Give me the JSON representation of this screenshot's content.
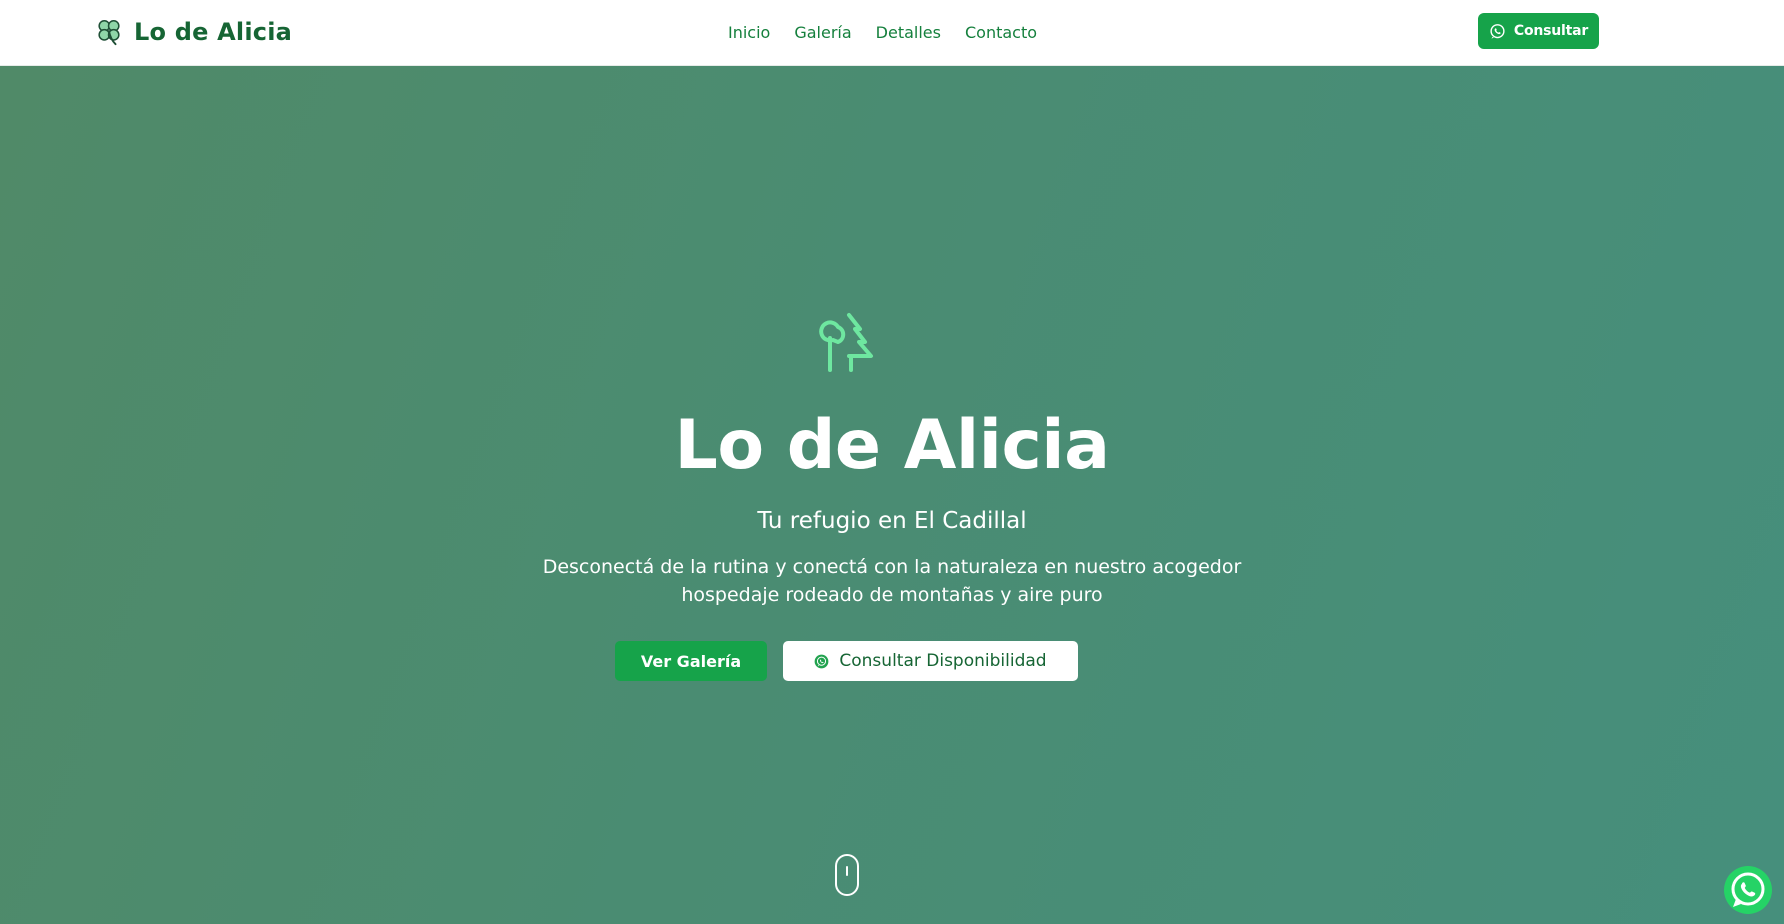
{
  "brand": {
    "name": "Lo de Alicia",
    "icon": "clover-icon"
  },
  "nav": {
    "items": [
      {
        "label": "Inicio"
      },
      {
        "label": "Galería"
      },
      {
        "label": "Detalles"
      },
      {
        "label": "Contacto"
      }
    ]
  },
  "header_cta": {
    "label": "Consultar",
    "icon": "whatsapp-icon"
  },
  "hero": {
    "icon": "trees-icon",
    "title": "Lo de Alicia",
    "subtitle": "Tu refugio en El Cadillal",
    "description": "Desconectá de la rutina y conectá con la naturaleza en nuestro acogedor hospedaje rodeado de montañas y aire puro",
    "primary_button": "Ver Galería",
    "secondary_button": "Consultar Disponibilidad",
    "scroll_icon": "mouse-scroll-icon"
  },
  "floating": {
    "icon": "whatsapp-icon"
  },
  "colors": {
    "brand_dark": "#166534",
    "brand_green": "#16a34a",
    "nav_link": "#15803d",
    "hero_bg": "#4a8c72",
    "tree_icon": "#6ee7a0",
    "whatsapp": "#25d366"
  }
}
